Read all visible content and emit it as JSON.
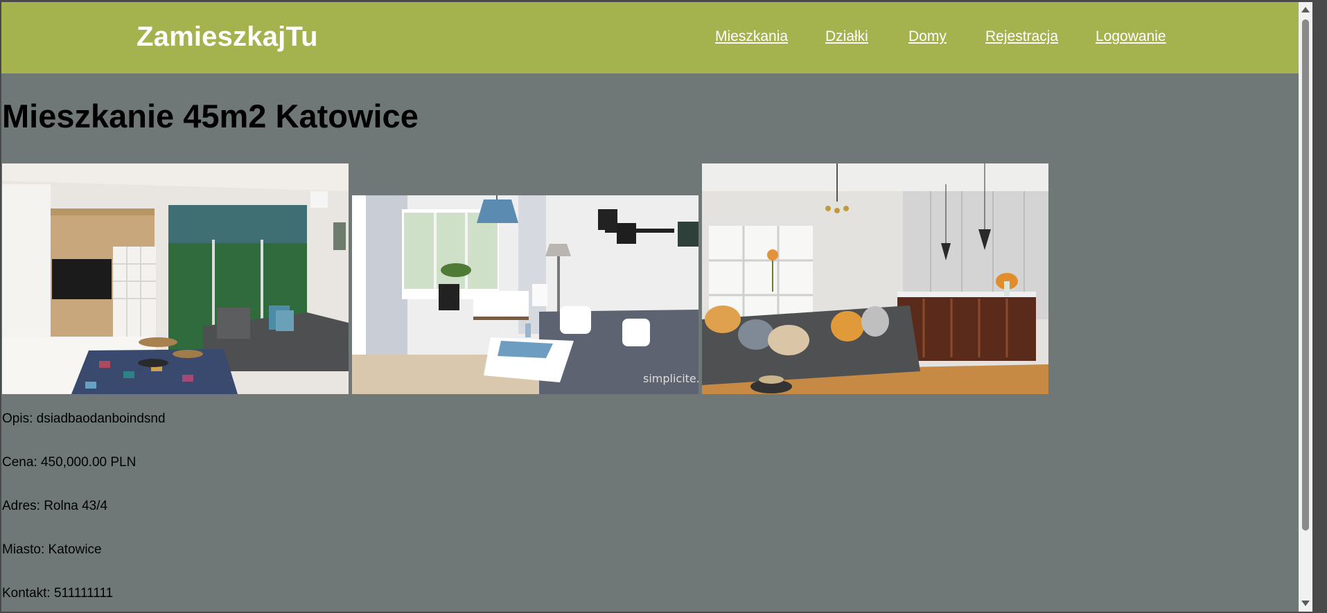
{
  "site": {
    "logo": "ZamieszkajTu"
  },
  "nav": {
    "items": [
      {
        "label": "Mieszkania"
      },
      {
        "label": "Działki"
      },
      {
        "label": "Domy"
      },
      {
        "label": "Rejestracja"
      },
      {
        "label": "Logowanie"
      }
    ]
  },
  "listing": {
    "title": "Mieszkanie 45m2 Katowice",
    "photos": [
      {
        "name": "living-room-photo-1"
      },
      {
        "name": "living-room-photo-2"
      },
      {
        "name": "living-room-photo-3"
      }
    ],
    "watermark": "simplicite.",
    "details": {
      "description": "Opis: dsiadbaodanboindsnd",
      "price": "Cena: 450,000.00 PLN",
      "address": "Adres: Rolna 43/4",
      "city": "Miasto: Katowice",
      "contact": "Kontakt: 511111111"
    }
  },
  "colors": {
    "header": "#a5b34f",
    "background": "#6f7876",
    "nav_text": "#ffffff"
  }
}
